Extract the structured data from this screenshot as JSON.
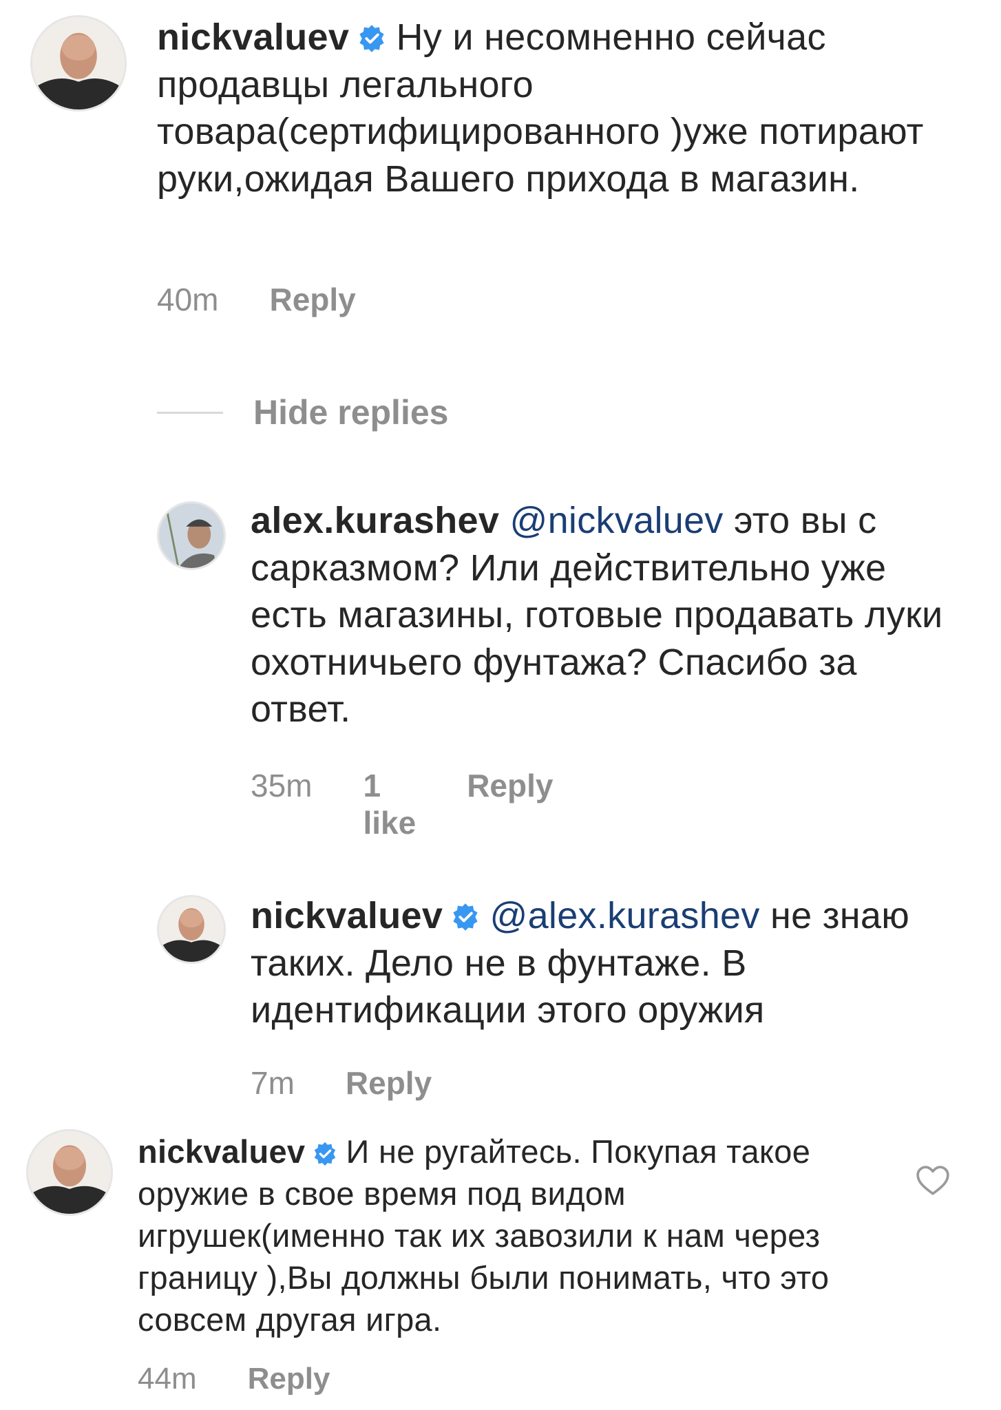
{
  "comments": [
    {
      "username": "nickvaluev",
      "text": "Ну и несомненно сейчас продавцы легального товара(сертифицированного )уже потирают руки,ожидая Вашего прихода в магазин.",
      "time": "40m",
      "reply_label": "Reply"
    },
    {
      "username": "alex.kurashev",
      "mention": "@nickvaluev",
      "text": " это вы с сарказмом? Или действительно уже есть магазины, готовые продавать луки охотничьего фунтажа? Спасибо за ответ.",
      "time": "35m",
      "likes": "1 like",
      "reply_label": "Reply"
    },
    {
      "username": "nickvaluev",
      "mention": "@alex.kurashev",
      "text": " не знаю таких. Дело не в фунтаже. В идентификации этого оружия",
      "time": "7m",
      "reply_label": "Reply"
    },
    {
      "username": "nickvaluev",
      "text": "И не ругайтесь.  Покупая такое оружие в свое время под видом игрушек(именно так их завозили к нам через границу ),Вы должны были понимать, что это совсем другая игра.",
      "time": "44m",
      "reply_label": "Reply"
    }
  ],
  "hide_replies_label": "Hide replies",
  "icons": {
    "verified": "verified-badge-icon",
    "like": "heart-outline-icon"
  },
  "colors": {
    "verified": "#3897f0",
    "mention": "#1a3e74",
    "meta": "#8e8e8e",
    "text": "#262626"
  }
}
